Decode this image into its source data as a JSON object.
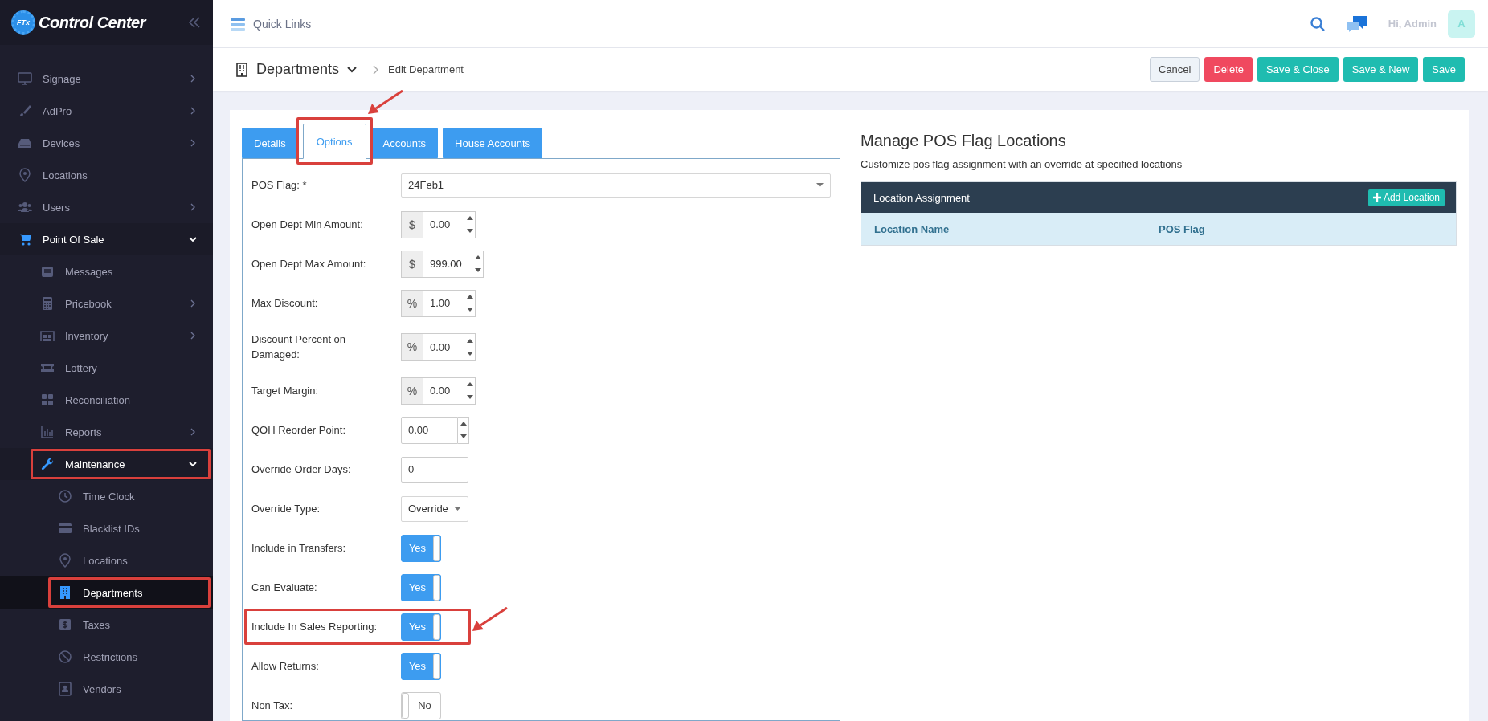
{
  "sidebar": {
    "logo_badge": "FTx",
    "logo_text": "Control Center",
    "items": [
      {
        "label": "Signage",
        "expandable": true,
        "expanded": false,
        "selected": false,
        "highlighted": false
      },
      {
        "label": "AdPro",
        "expandable": true,
        "expanded": false,
        "selected": false,
        "highlighted": false
      },
      {
        "label": "Devices",
        "expandable": true,
        "expanded": false,
        "selected": false,
        "highlighted": false
      },
      {
        "label": "Locations",
        "expandable": false,
        "expanded": false,
        "selected": false,
        "highlighted": false
      },
      {
        "label": "Users",
        "expandable": true,
        "expanded": false,
        "selected": false,
        "highlighted": false
      },
      {
        "label": "Point Of Sale",
        "expandable": true,
        "expanded": true,
        "selected": false,
        "highlighted": false,
        "children": [
          {
            "label": "Messages",
            "expandable": false,
            "expanded": false,
            "selected": false,
            "highlighted": false
          },
          {
            "label": "Pricebook",
            "expandable": true,
            "expanded": false,
            "selected": false,
            "highlighted": false
          },
          {
            "label": "Inventory",
            "expandable": true,
            "expanded": false,
            "selected": false,
            "highlighted": false
          },
          {
            "label": "Lottery",
            "expandable": false,
            "expanded": false,
            "selected": false,
            "highlighted": false
          },
          {
            "label": "Reconciliation",
            "expandable": false,
            "expanded": false,
            "selected": false,
            "highlighted": false
          },
          {
            "label": "Reports",
            "expandable": true,
            "expanded": false,
            "selected": false,
            "highlighted": false
          },
          {
            "label": "Maintenance",
            "expandable": true,
            "expanded": true,
            "selected": false,
            "highlighted": true,
            "children": [
              {
                "label": "Time Clock",
                "expandable": false,
                "expanded": false,
                "selected": false,
                "highlighted": false
              },
              {
                "label": "Blacklist IDs",
                "expandable": false,
                "expanded": false,
                "selected": false,
                "highlighted": false
              },
              {
                "label": "Locations",
                "expandable": false,
                "expanded": false,
                "selected": false,
                "highlighted": false
              },
              {
                "label": "Departments",
                "expandable": false,
                "expanded": false,
                "selected": true,
                "highlighted": true
              },
              {
                "label": "Taxes",
                "expandable": false,
                "expanded": false,
                "selected": false,
                "highlighted": false
              },
              {
                "label": "Restrictions",
                "expandable": false,
                "expanded": false,
                "selected": false,
                "highlighted": false
              },
              {
                "label": "Vendors",
                "expandable": false,
                "expanded": false,
                "selected": false,
                "highlighted": false
              }
            ]
          }
        ]
      }
    ]
  },
  "top_bar": {
    "quick_links": "Quick Links",
    "user_greeting": "Hi, Admin",
    "avatar": "A"
  },
  "header": {
    "title": "Departments",
    "breadcrumb": "Edit Department",
    "buttons": [
      {
        "label": "Cancel",
        "kind": "default"
      },
      {
        "label": "Delete",
        "kind": "danger"
      },
      {
        "label": "Save & Close",
        "kind": "primary"
      },
      {
        "label": "Save & New",
        "kind": "primary"
      },
      {
        "label": "Save",
        "kind": "primary"
      }
    ]
  },
  "form": {
    "tabs": [
      {
        "label": "Details",
        "selected": false
      },
      {
        "label": "Options",
        "selected": true
      },
      {
        "label": "Accounts",
        "selected": false
      },
      {
        "label": "House Accounts",
        "selected": false
      }
    ],
    "selected_tab_callout": true,
    "fields": [
      {
        "kind": "select",
        "label": "POS Flag: *",
        "value": "24Feb1",
        "highlighted": false
      },
      {
        "kind": "number",
        "label": "Open Dept Min Amount:",
        "prefix": "$",
        "value": "0.00",
        "highlighted": false
      },
      {
        "kind": "number",
        "label": "Open Dept Max Amount:",
        "prefix": "$",
        "value": "999.00",
        "highlighted": false
      },
      {
        "kind": "number",
        "label": "Max Discount:",
        "prefix": "%",
        "value": "1.00",
        "highlighted": false
      },
      {
        "kind": "number",
        "label": "Discount Percent on Damaged:",
        "prefix": "%",
        "value": "0.00",
        "highlighted": false
      },
      {
        "kind": "number",
        "label": "Target Margin:",
        "prefix": "%",
        "value": "0.00",
        "highlighted": false
      },
      {
        "kind": "number",
        "label": "QOH Reorder Point:",
        "value": "0.00",
        "highlighted": false
      },
      {
        "kind": "text",
        "label": "Override Order Days:",
        "value": "0",
        "highlighted": false
      },
      {
        "kind": "dropdown",
        "label": "Override Type:",
        "value": "Override",
        "highlighted": false
      },
      {
        "kind": "toggle",
        "label": "Include in Transfers:",
        "on": true,
        "text": "Yes",
        "highlighted": false
      },
      {
        "kind": "toggle",
        "label": "Can Evaluate:",
        "on": true,
        "text": "Yes",
        "highlighted": false
      },
      {
        "kind": "toggle",
        "label": "Include In Sales Reporting:",
        "on": true,
        "text": "Yes",
        "highlighted": true
      },
      {
        "kind": "toggle",
        "label": "Allow Returns:",
        "on": true,
        "text": "Yes",
        "highlighted": false
      },
      {
        "kind": "toggle",
        "label": "Non Tax:",
        "on": false,
        "text": "No",
        "highlighted": false
      }
    ]
  },
  "pos_panel": {
    "title": "Manage POS Flag Locations",
    "subtitle": "Customize pos flag assignment with an override at specified locations",
    "table_title": "Location Assignment",
    "add_button": "Add Location",
    "columns": [
      "Location Name",
      "POS Flag"
    ]
  }
}
